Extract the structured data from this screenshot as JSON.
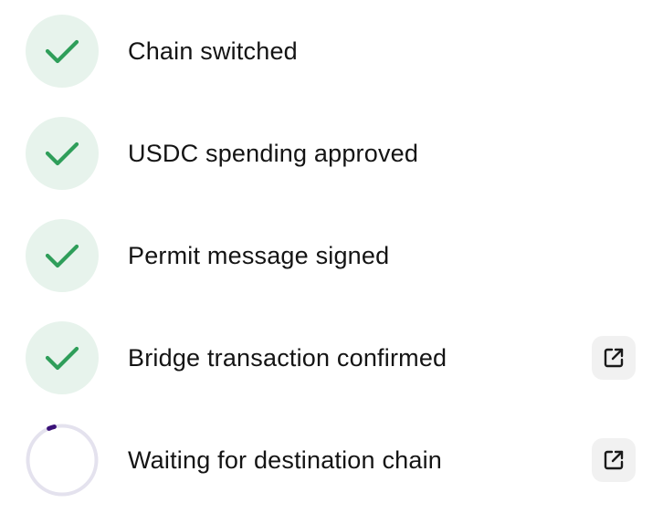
{
  "steps": [
    {
      "label": "Chain switched",
      "status": "done",
      "status_icon": "check-icon"
    },
    {
      "label": "USDC spending approved",
      "status": "done",
      "status_icon": "check-icon"
    },
    {
      "label": "Permit message signed",
      "status": "done",
      "status_icon": "check-icon"
    },
    {
      "label": "Bridge transaction confirmed",
      "status": "done",
      "status_icon": "check-icon",
      "link_icon": "external-link-icon"
    },
    {
      "label": "Waiting for destination chain",
      "status": "pending",
      "status_icon": "spinner-icon",
      "link_icon": "external-link-icon"
    }
  ],
  "colors": {
    "done_bg": "#e7f3ec",
    "check": "#2f9e5a",
    "spinner_track": "#e4e2ee",
    "spinner_arc": "#3a1178",
    "link_bg": "#f1f1f1",
    "text": "#141414"
  }
}
